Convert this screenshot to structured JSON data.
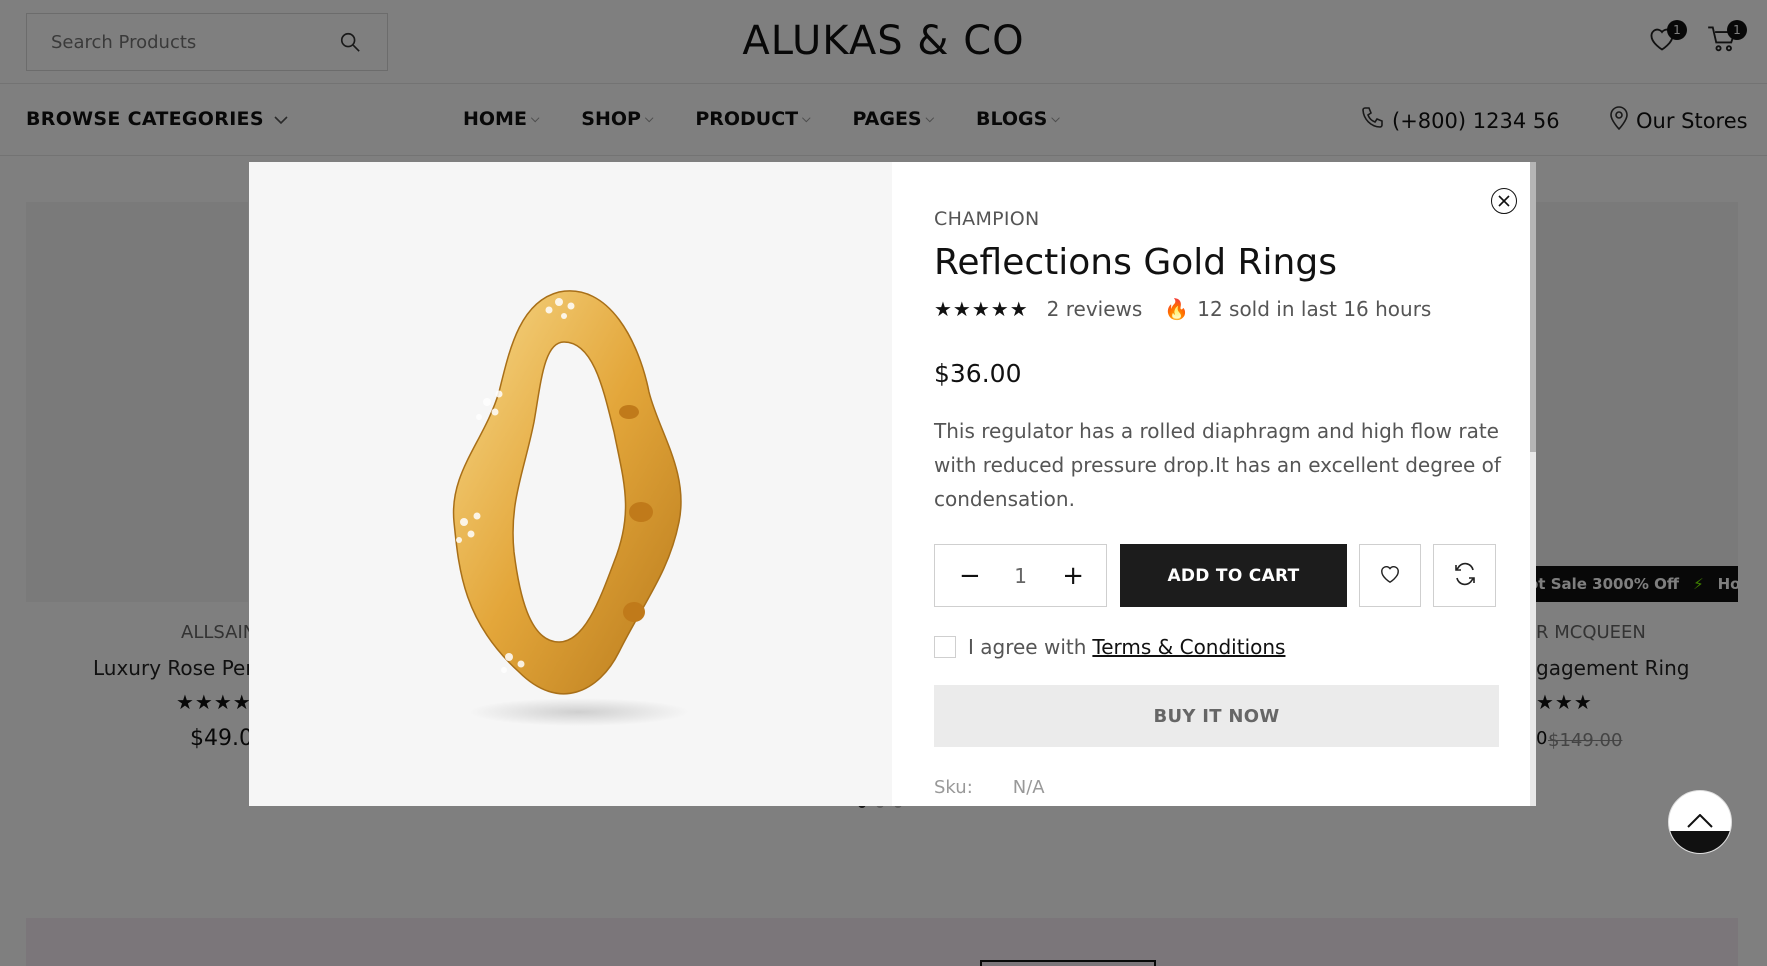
{
  "header": {
    "search_placeholder": "Search Products",
    "logo": "ALUKAS & CO",
    "wishlist_count": "1",
    "cart_count": "1"
  },
  "nav": {
    "browse_label": "BROWSE CATEGORIES",
    "items": [
      {
        "label": "HOME"
      },
      {
        "label": "SHOP"
      },
      {
        "label": "PRODUCT"
      },
      {
        "label": "PAGES"
      },
      {
        "label": "BLOGS"
      }
    ],
    "phone": "(+800) 1234 56",
    "stores": "Our Stores"
  },
  "background_cards": {
    "left": {
      "brand": "ALLSAIN",
      "title": "Luxury Rose Penc",
      "stars": "★★★★",
      "price": "$49.0"
    },
    "right": {
      "brand": "R MCQUEEN",
      "title": "gagement Ring",
      "stars": "★★★",
      "price": "0",
      "old_price": "$149.00"
    },
    "ticker": [
      "ot Sale 3000% Off",
      "Hot S"
    ]
  },
  "modal": {
    "brand": "CHAMPION",
    "title": "Reflections Gold Rings",
    "stars": "★★★★★",
    "reviews": "2 reviews",
    "sold": "12 sold in last 16 hours",
    "price": "$36.00",
    "description": "This regulator has a rolled diaphragm and high flow rate with reduced pressure drop.It has an excellent degree of condensation.",
    "quantity": "1",
    "add_to_cart": "ADD TO CART",
    "agree_text": "I agree with",
    "terms_link": "Terms & Conditions",
    "buy_now": "BUY IT NOW",
    "sku_label": "Sku:",
    "sku_value": "N/A"
  },
  "colors": {
    "accent": "#1c1c1c",
    "overlay": "rgba(0,0,0,0.5)",
    "gold": "#e0a93a",
    "fire": "#e8401c"
  }
}
